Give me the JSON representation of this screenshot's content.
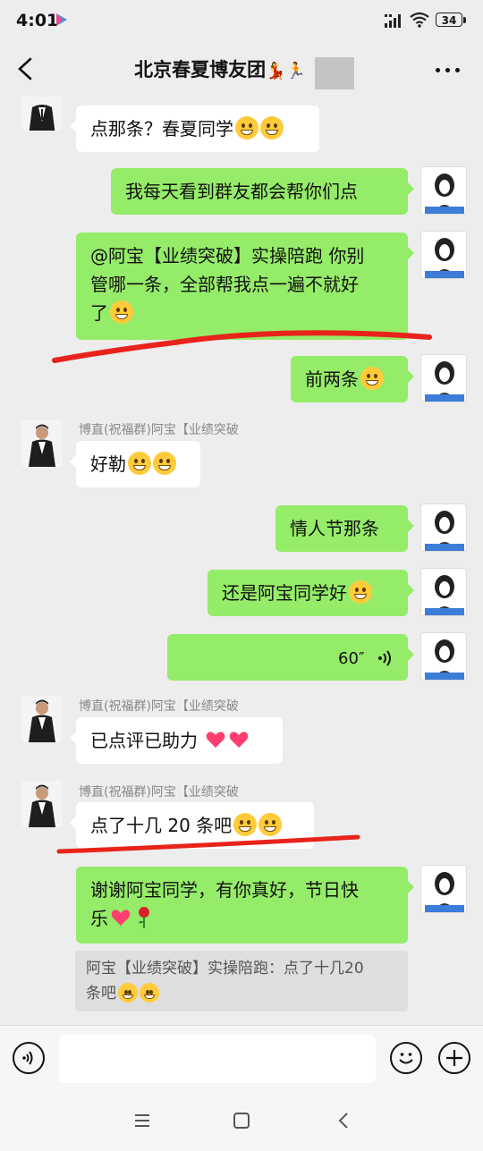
{
  "status_bar": {
    "time": "4:01",
    "battery": "34"
  },
  "header": {
    "title": "北京春夏博友团",
    "title_emoji": "💃🏃"
  },
  "messages": {
    "m1": {
      "text": "点那条？春夏同学"
    },
    "m2": {
      "text": "我每天看到群友都会帮你们点"
    },
    "m3": {
      "line1": "@阿宝【业绩突破】实操陪跑  你别",
      "line2": "管哪一条，全部帮我点一遍不就好",
      "line3": "了"
    },
    "m4": {
      "text": "前两条"
    },
    "m5": {
      "sender": "博直(祝福群)阿宝【业绩突破",
      "text": "好勒"
    },
    "m6": {
      "text": "情人节那条"
    },
    "m7": {
      "text": "还是阿宝同学好"
    },
    "m8": {
      "duration": "60″"
    },
    "m9": {
      "sender": "博直(祝福群)阿宝【业绩突破",
      "text": "已点评已助力"
    },
    "m10": {
      "sender": "博直(祝福群)阿宝【业绩突破",
      "text": "点了十几 20 条吧"
    },
    "m11": {
      "line1": "谢谢阿宝同学，有你真好，节日快",
      "line2": "乐"
    },
    "quote": {
      "line1": "阿宝【业绩突破】实操陪跑：点了十几20",
      "line2": "条吧"
    }
  },
  "avatar_me_caption": "拜冬学习",
  "colors": {
    "my_bubble": "#95ec69",
    "other_bubble": "#ffffff",
    "background": "#ededed",
    "annotation": "#e8231b"
  }
}
